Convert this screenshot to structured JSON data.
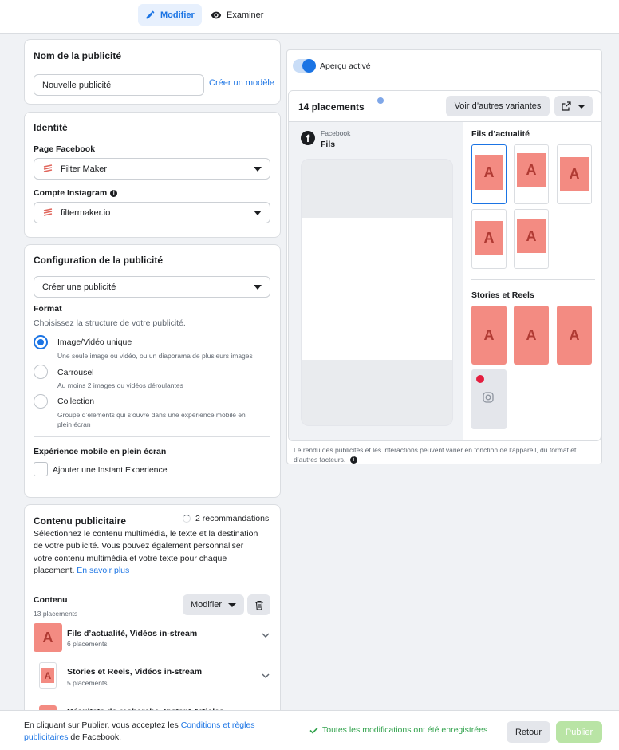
{
  "tabs": {
    "edit": "Modifier",
    "review": "Examiner"
  },
  "ad_name": {
    "title": "Nom de la publicité",
    "value": "Nouvelle publicité",
    "template_link": "Créer un modèle"
  },
  "identity": {
    "title": "Identité",
    "fb_page_label": "Page Facebook",
    "fb_page_value": "Filter Maker",
    "ig_label": "Compte Instagram",
    "ig_value": "filtermaker.io"
  },
  "config": {
    "title": "Configuration de la publicité",
    "select_value": "Créer une publicité",
    "format_label": "Format",
    "format_desc": "Choisissez la structure de votre publicité.",
    "options": [
      {
        "label": "Image/Vidéo unique",
        "desc": "Une seule image ou vidéo, ou un diaporama de plusieurs images",
        "selected": true
      },
      {
        "label": "Carrousel",
        "desc": "Au moins 2 images ou vidéos déroulantes",
        "selected": false
      },
      {
        "label": "Collection",
        "desc1": "Groupe d’éléments qui s’ouvre dans une expérience mobile en",
        "desc2": "plein écran",
        "selected": false
      }
    ],
    "mobile_label": "Expérience mobile en plein écran",
    "instant_label": "Ajouter une Instant Experience"
  },
  "content": {
    "title": "Contenu publicitaire",
    "recommendations": "2 recommandations",
    "desc_lines": [
      "Sélectionnez le contenu multimédia, le texte et la destination",
      "de votre publicité. Vous pouvez également personnaliser",
      "votre contenu multimédia et votre texte pour chaque"
    ],
    "desc_last": "placement.",
    "learn_more": "En savoir plus",
    "contenu_label": "Contenu",
    "placements_count": "13 placements",
    "modify_label": "Modifier",
    "groups": [
      {
        "name": "Fils d’actualité, Vidéos in-stream",
        "count": "6 placements"
      },
      {
        "name": "Stories et Reels, Vidéos in-stream",
        "count": "5 placements"
      },
      {
        "name": "Résultats de recherche, Instant Articles",
        "count": ""
      }
    ]
  },
  "preview": {
    "toggle_label": "Aperçu activé",
    "placements": "14 placements",
    "variants_button": "Voir d’autres variantes",
    "fb_label": "Facebook",
    "fb_sub": "Fils",
    "feeds_title": "Fils d’actualité",
    "stories_title": "Stories et Reels",
    "disclaimer1": "Le rendu des publicités et les interactions peuvent varier en fonction de l’appareil, du format et",
    "disclaimer2": "d’autres facteurs."
  },
  "thumb_letter": "A",
  "footer": {
    "text1": "En cliquant sur Publier, vous acceptez les",
    "terms_link1": "Conditions et règles",
    "terms_link2": "publicitaires",
    "text2": "de Facebook.",
    "saved": "Toutes les modifications ont été enregistrées",
    "back": "Retour",
    "publish": "Publier"
  },
  "colors": {
    "accent": "#1b74e4",
    "ad_image": "#f38b82",
    "success": "#31a24c",
    "publish_disabled": "#b9e4a5"
  }
}
